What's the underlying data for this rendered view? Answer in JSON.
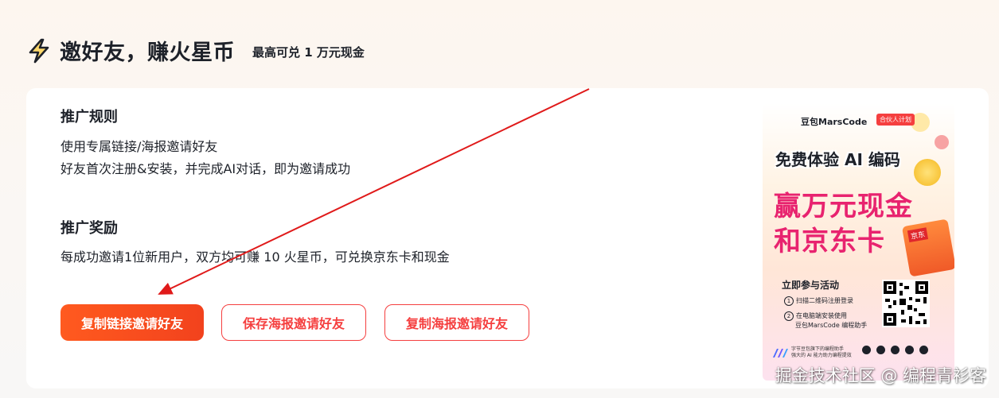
{
  "header": {
    "title": "邀好友，赚火星币",
    "subtitle": "最高可兑 1 万元现金"
  },
  "rules": {
    "title": "推广规则",
    "lines": [
      "使用专属链接/海报邀请好友",
      "好友首次注册&安装，并完成AI对话，即为邀请成功"
    ]
  },
  "rewards": {
    "title": "推广奖励",
    "text": "每成功邀请1位新用户，双方均可赚 10 火星币，可兑换京东卡和现金"
  },
  "buttons": {
    "copy_link": "复制链接邀请好友",
    "save_poster": "保存海报邀请好友",
    "copy_poster": "复制海报邀请好友"
  },
  "poster": {
    "brand": "豆包MarsCode",
    "brand_tag": "合伙人计划",
    "headline": "免费体验 AI 编码",
    "big_line_1": "赢万元现金",
    "big_line_2": "和京东卡",
    "card_label": "京东",
    "join": "立即参与活动",
    "step_1": "扫描二维码注册登录",
    "step_2_a": "在电脑端安装使用",
    "step_2_b": "豆包MarsCode 编程助手",
    "foot_line_1": "字节豆包旗下的编程助手",
    "foot_line_2": "强大的 AI 能力助力编程提效"
  },
  "watermark": "掘金技术社区 @ 编程青衫客",
  "colors": {
    "accent": "#f53f3f",
    "primary_gradient_start": "#ff5a1f",
    "poster_pink": "#e8236f",
    "arrow": "#e01a1a"
  }
}
